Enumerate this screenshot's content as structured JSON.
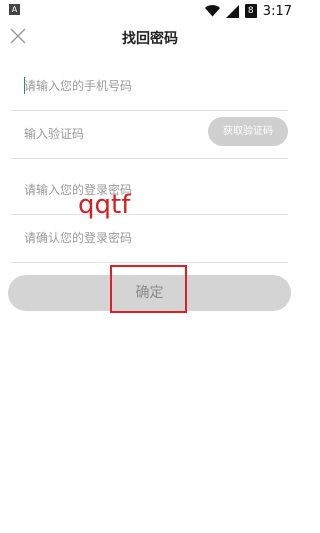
{
  "status_bar": {
    "app_icon_letter": "A",
    "time": "3:17",
    "battery_level": "8",
    "icons": [
      "wifi-icon",
      "signal-icon",
      "battery-icon"
    ]
  },
  "header": {
    "title": "找回密码",
    "close_icon": "close-icon"
  },
  "form": {
    "phone_placeholder": "请输入您的手机号码",
    "code_placeholder": "输入验证码",
    "get_code_label": "获取验证码",
    "password_placeholder": "请输入您的登录密码",
    "confirm_placeholder": "请确认您的登录密码"
  },
  "submit_label": "确定",
  "watermark_text": "qqtf",
  "colors": {
    "highlight": "#e02020",
    "button_disabled": "#d4d4d4",
    "code_button": "#cfcfcf",
    "caret": "#2a8b6f",
    "watermark": "#d81e1e"
  }
}
